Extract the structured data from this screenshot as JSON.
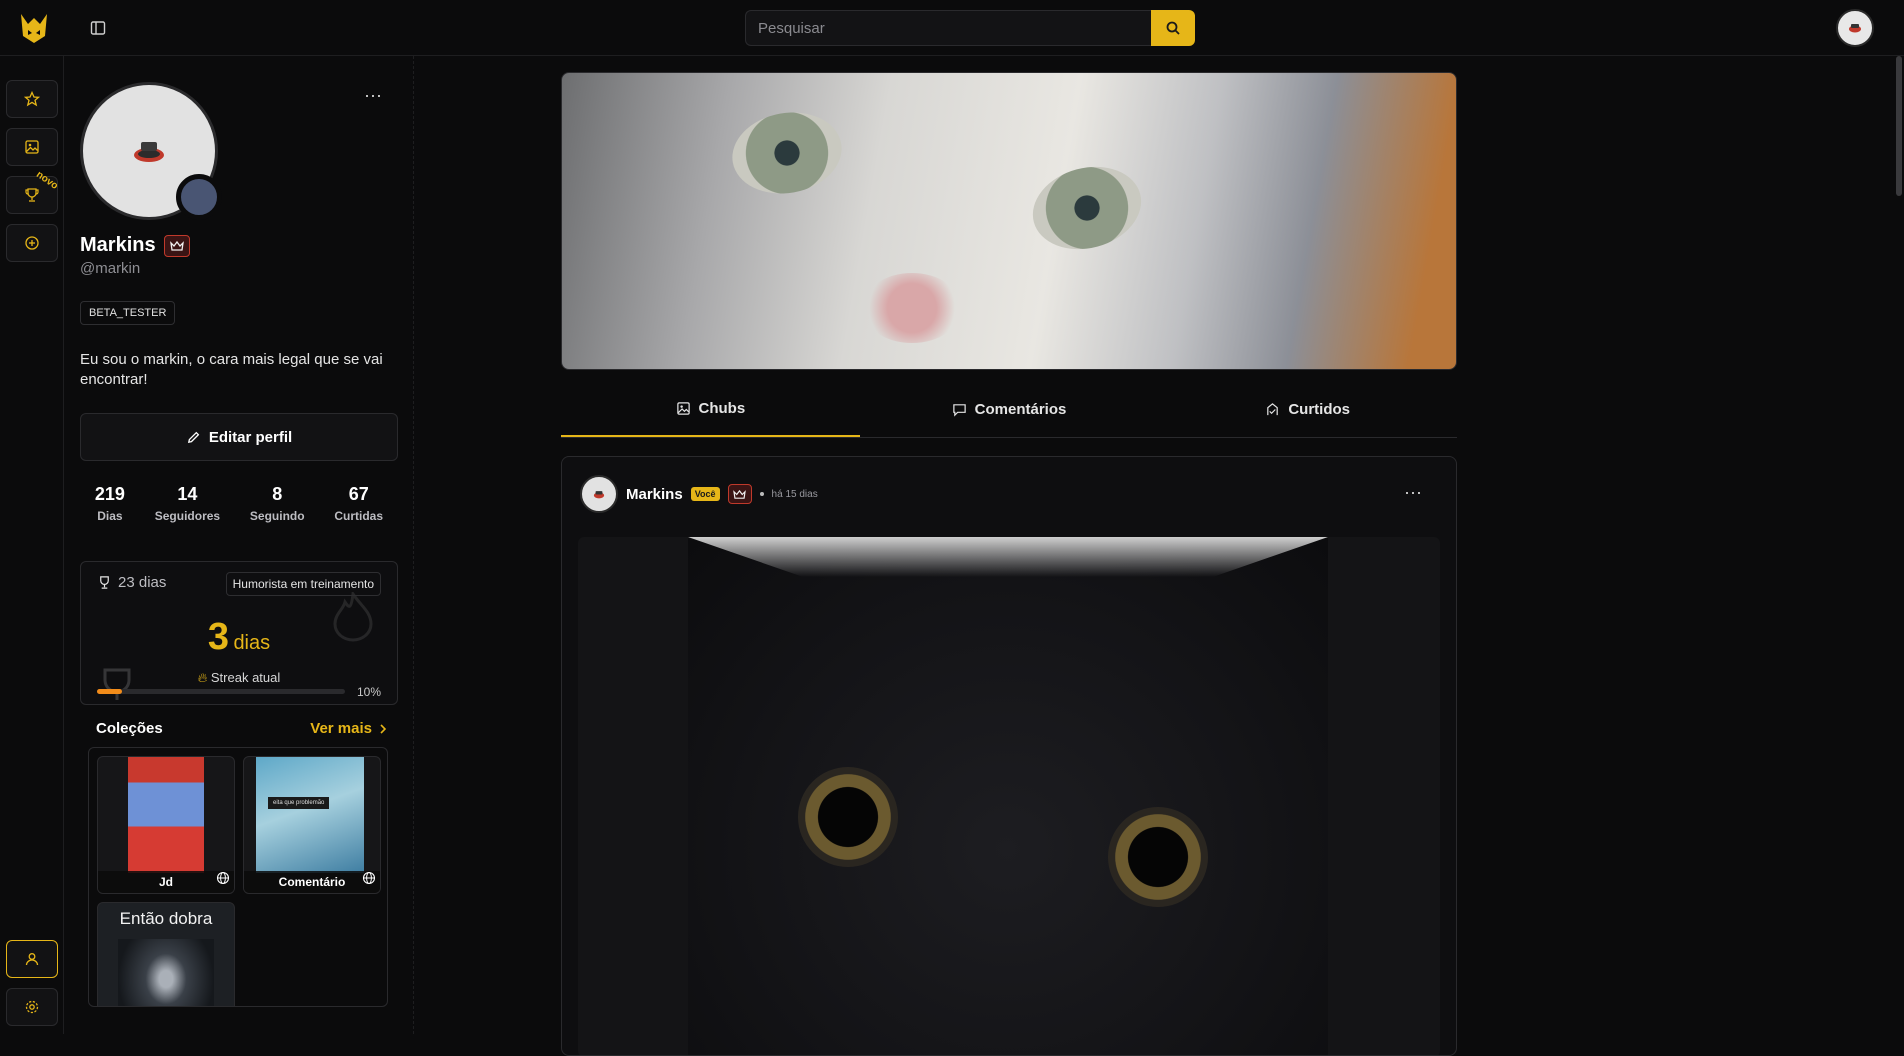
{
  "header": {
    "search_placeholder": "Pesquisar"
  },
  "rail": {
    "items": [
      "favorites",
      "gallery",
      "trophies",
      "add"
    ],
    "trophy_badge": "novo"
  },
  "profile": {
    "name": "Markins",
    "handle": "@markin",
    "badge": "BETA_TESTER",
    "bio": "Eu sou o markin, o cara mais legal que se vai encontrar!",
    "edit_label": "Editar perfil",
    "stats": [
      {
        "num": "219",
        "label": "Dias"
      },
      {
        "num": "14",
        "label": "Seguidores"
      },
      {
        "num": "8",
        "label": "Seguindo"
      },
      {
        "num": "67",
        "label": "Curtidas"
      }
    ],
    "streak": {
      "days_total": "23 dias",
      "rank": "Humorista em treinamento",
      "current": "3",
      "unit": "dias",
      "label": "Streak atual",
      "progress_pct": 10,
      "progress_text": "10%"
    },
    "collections": {
      "title": "Coleções",
      "more": "Ver mais",
      "items": [
        {
          "label": "Jd"
        },
        {
          "label": "Comentário",
          "caption": "eita que problemão"
        },
        {
          "label": "Então dobra"
        }
      ]
    }
  },
  "tabs": [
    {
      "label": "Chubs",
      "active": true
    },
    {
      "label": "Comentários",
      "active": false
    },
    {
      "label": "Curtidos",
      "active": false
    }
  ],
  "post": {
    "author": "Markins",
    "you_badge": "Você",
    "time": "há 15 dias"
  },
  "colors": {
    "accent": "#e6b618",
    "background": "#0b0b0c",
    "progress": "#f28c1a",
    "crown": "#c0392b"
  }
}
